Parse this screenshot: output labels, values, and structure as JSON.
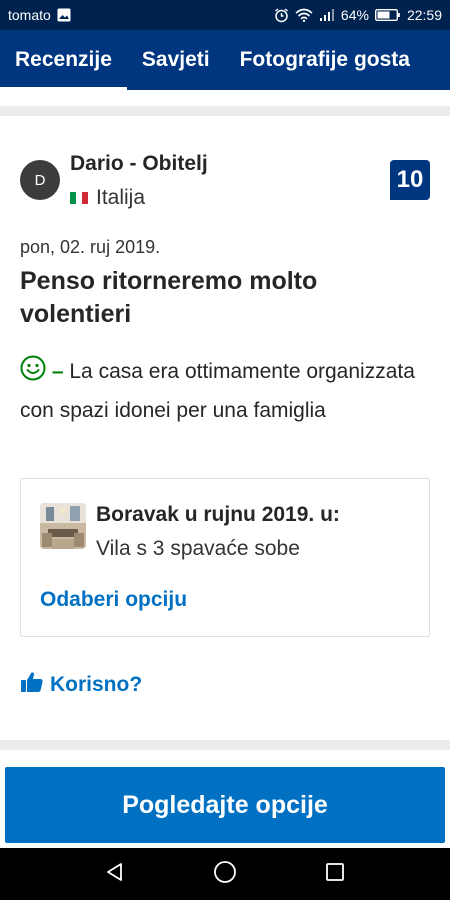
{
  "status_bar": {
    "carrier": "tomato",
    "battery": "64%",
    "time": "22:59"
  },
  "tabs": [
    {
      "label": "Recenzije",
      "active": true
    },
    {
      "label": "Savjeti",
      "active": false
    },
    {
      "label": "Fotografije gosta",
      "active": false
    }
  ],
  "review": {
    "avatar_initial": "D",
    "reviewer_name": "Dario - Obitelj",
    "country": "Italija",
    "score": "10",
    "date": "pon, 02. ruj 2019.",
    "title": "Penso ritorneremo molto volentieri",
    "positive_dash": "–",
    "positive_text": "La casa era ottimamente organizzata con spazi idonei per una famiglia"
  },
  "stay": {
    "title": "Boravak u rujnu 2019. u:",
    "room": "Vila s 3 spavaće sobe",
    "choose_label": "Odaberi opciju"
  },
  "helpful_label": "Korisno?",
  "primary_button": "Pogledajte opcije",
  "colors": {
    "brand_dark": "#003580",
    "status_bar": "#00224f",
    "link": "#0071c2",
    "positive": "#008009"
  },
  "icons": {
    "gallery": "image-icon",
    "alarm": "alarm-icon",
    "wifi": "wifi-icon",
    "signal": "signal-icon",
    "battery": "battery-icon",
    "smile": "smile-icon",
    "thumb": "thumbs-up-icon",
    "back": "back-icon",
    "home": "home-icon",
    "recents": "recents-icon"
  }
}
